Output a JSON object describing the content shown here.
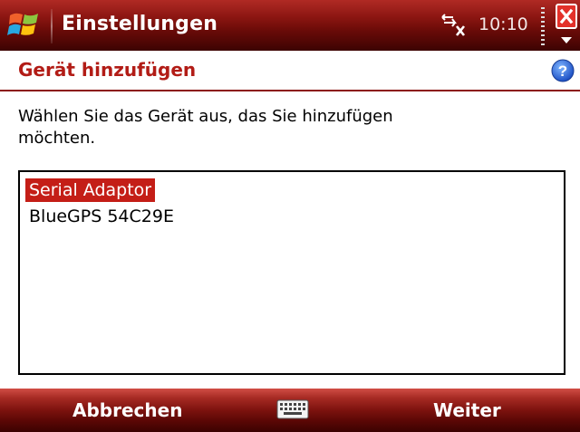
{
  "titlebar": {
    "title": "Einstellungen",
    "time": "10:10",
    "start_icon": "windows-start-icon",
    "connectivity_icon": "connectivity-icon",
    "close_icon": "close-icon",
    "overflow_icon": "chevron-down-icon"
  },
  "page": {
    "title": "Gerät hinzufügen",
    "help_icon": "help-icon",
    "instructions": "Wählen Sie das Gerät aus, das Sie hinzufügen möchten.",
    "devices": [
      {
        "label": "Serial Adaptor",
        "selected": true
      },
      {
        "label": "BlueGPS 54C29E",
        "selected": false
      }
    ]
  },
  "softkeys": {
    "left": "Abbrechen",
    "right": "Weiter",
    "center_icon": "keyboard-icon"
  },
  "colors": {
    "accent_red": "#b21c16",
    "selection": "#c41e17",
    "bar_dark": "#6a0b08"
  }
}
